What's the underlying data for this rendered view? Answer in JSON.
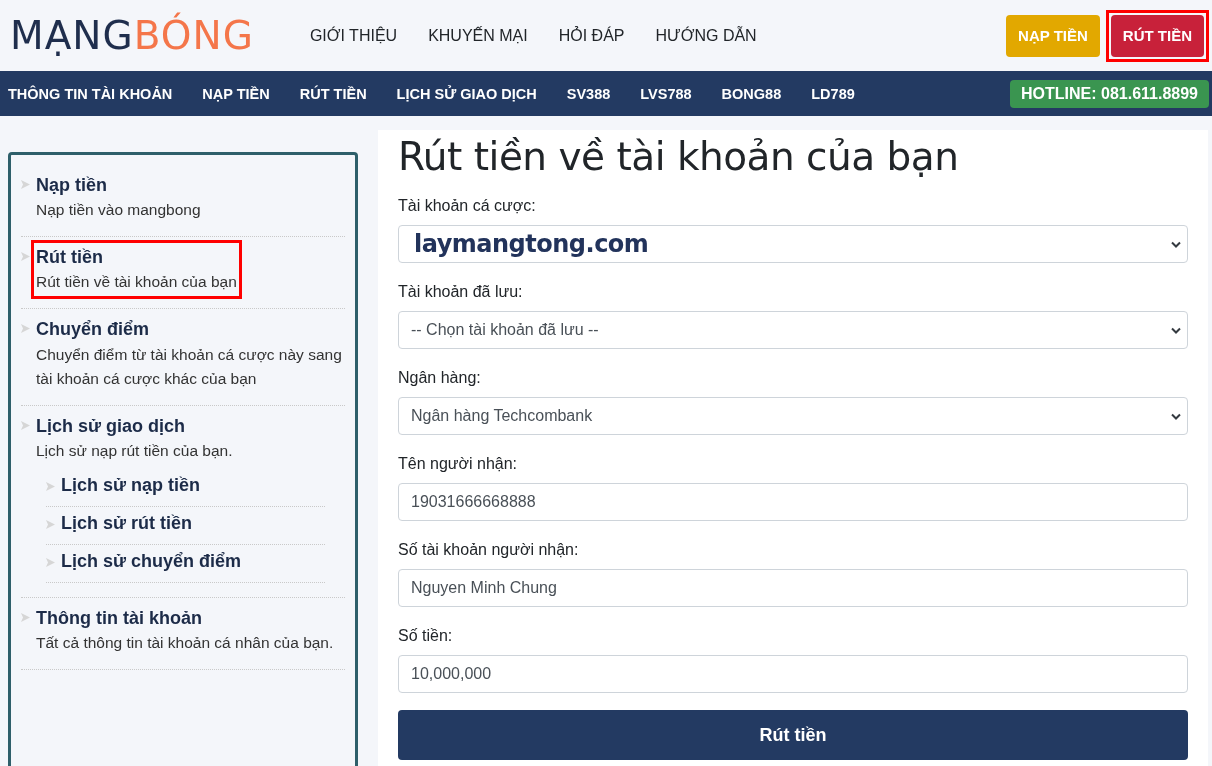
{
  "header": {
    "logo": {
      "part_1": "MẠNG",
      "part_2": "BÓNG"
    },
    "nav": [
      "GIỚI THIỆU",
      "KHUYẾN MẠI",
      "HỎI ĐÁP",
      "HƯỚNG DẪN"
    ],
    "buttons": [
      {
        "label": "NẠP TIỀN",
        "kind": "deposit",
        "highlighted": false
      },
      {
        "label": "RÚT TIỀN",
        "kind": "withdraw",
        "highlighted": true
      }
    ]
  },
  "menu_bar": {
    "items": [
      "THÔNG TIN TÀI KHOẢN",
      "NẠP TIỀN",
      "RÚT TIỀN",
      "LỊCH SỬ GIAO DỊCH",
      "SV388",
      "LVS788",
      "BONG88",
      "LD789"
    ],
    "hotline": "HOTLINE: 081.611.8899"
  },
  "sidebar": {
    "items": [
      {
        "title": "Nạp tiền",
        "description": "Nạp tiền vào mangbong",
        "highlighted": false
      },
      {
        "title": "Rút tiền",
        "description": "Rút tiền về tài khoản của bạn",
        "highlighted": true
      },
      {
        "title": "Chuyển điểm",
        "description": "Chuyển điểm từ tài khoản cá cược này sang tài khoản cá cược khác của bạn",
        "highlighted": false
      },
      {
        "title": "Lịch sử giao dịch",
        "description": "Lịch sử nạp rút tiền của bạn.",
        "highlighted": false,
        "children": [
          {
            "title": "Lịch sử nạp tiền"
          },
          {
            "title": "Lịch sử rút tiền"
          },
          {
            "title": "Lịch sử chuyển điểm"
          }
        ]
      },
      {
        "title": "Thông tin tài khoản",
        "description": "Tất cả thông tin tài khoản cá nhân của bạn.",
        "highlighted": false
      }
    ]
  },
  "form": {
    "title": "Rút tiền về tài khoản của bạn",
    "fields": [
      {
        "label": "Tài khoản cá cược:",
        "kind": "select",
        "value": "laymangtong.com",
        "emphasis": true
      },
      {
        "label": "Tài khoản đã lưu:",
        "kind": "select",
        "value": "-- Chọn tài khoản đã lưu --",
        "emphasis": false
      },
      {
        "label": "Ngân hàng:",
        "kind": "select",
        "value": "Ngân hàng Techcombank",
        "emphasis": false
      },
      {
        "label": "Tên người nhận:",
        "kind": "input",
        "value": "19031666668888",
        "emphasis": false
      },
      {
        "label": "Số tài khoản người nhận:",
        "kind": "input",
        "value": "Nguyen Minh Chung",
        "emphasis": false
      },
      {
        "label": "Số tiền:",
        "kind": "input",
        "value": "10,000,000",
        "emphasis": false
      }
    ],
    "submit": "Rút tiền"
  }
}
